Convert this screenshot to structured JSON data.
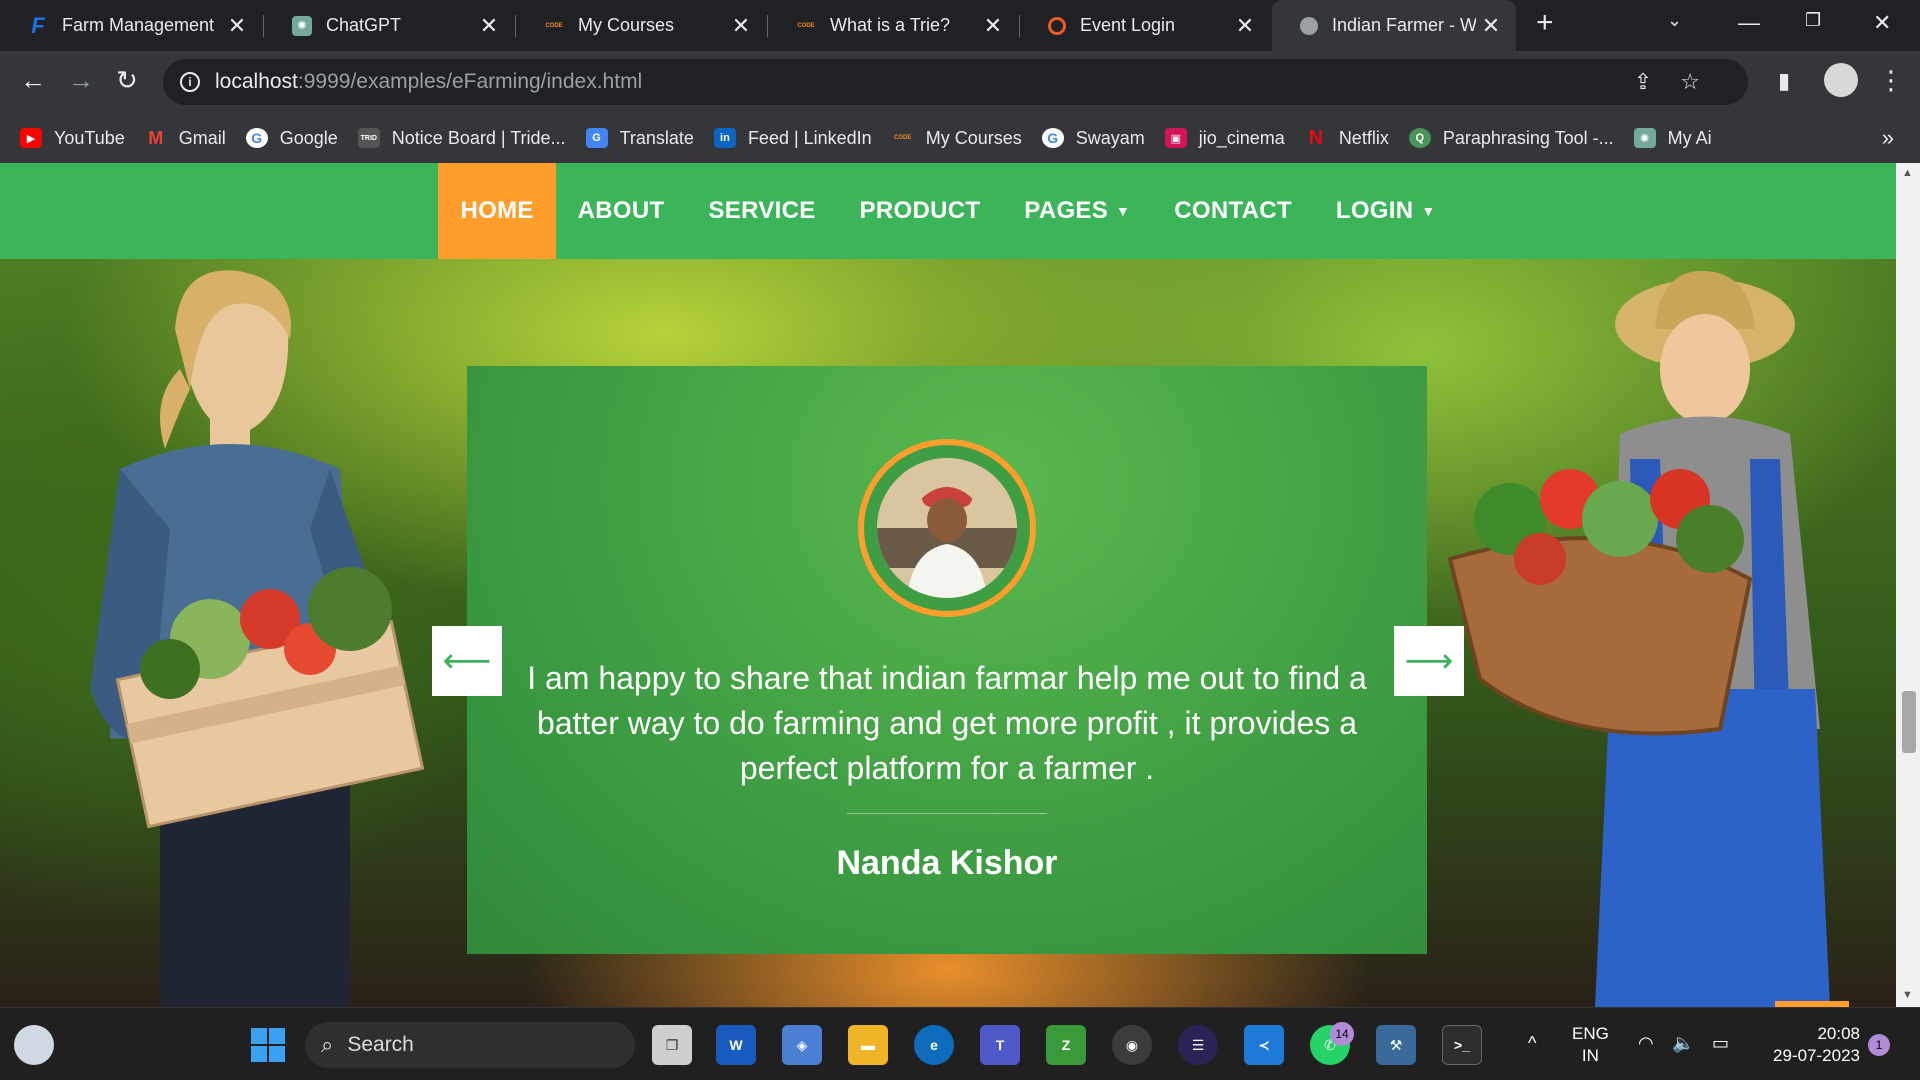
{
  "tabs": [
    {
      "title": "Farm Management",
      "icon": "farm-management-favicon"
    },
    {
      "title": "ChatGPT",
      "icon": "chatgpt-favicon"
    },
    {
      "title": "My Courses",
      "icon": "coding-ninjas-favicon"
    },
    {
      "title": "What is a Trie?",
      "icon": "coding-ninjas-favicon"
    },
    {
      "title": "Event Login",
      "icon": "event-login-favicon"
    },
    {
      "title": "Indian Farmer - We",
      "icon": "globe-favicon"
    }
  ],
  "address_bar": {
    "host": "localhost",
    "path": ":9999/examples/eFarming/index.html"
  },
  "bookmarks": [
    {
      "label": "YouTube",
      "icon": "youtube-icon",
      "color": "#ff0000"
    },
    {
      "label": "Gmail",
      "icon": "gmail-icon",
      "color": "#ea4335"
    },
    {
      "label": "Google",
      "icon": "google-icon",
      "color": "#4285f4"
    },
    {
      "label": "Notice Board | Tride...",
      "icon": "trident-icon",
      "color": "#555555"
    },
    {
      "label": "Translate",
      "icon": "translate-icon",
      "color": "#4285f4"
    },
    {
      "label": "Feed | LinkedIn",
      "icon": "linkedin-icon",
      "color": "#0a66c2"
    },
    {
      "label": "My Courses",
      "icon": "coding-ninjas-icon",
      "color": "#f08a24"
    },
    {
      "label": "Swayam",
      "icon": "google-icon",
      "color": "#4285f4"
    },
    {
      "label": "jio_cinema",
      "icon": "jiocinema-icon",
      "color": "#d4145a"
    },
    {
      "label": "Netflix",
      "icon": "netflix-icon",
      "color": "#e50914"
    },
    {
      "label": "Paraphrasing Tool -...",
      "icon": "quillbot-icon",
      "color": "#499557"
    },
    {
      "label": "My Ai",
      "icon": "chatgpt-icon",
      "color": "#74aa9c"
    }
  ],
  "nav": {
    "home": "HOME",
    "about": "ABOUT",
    "service": "SERVICE",
    "product": "PRODUCT",
    "pages": "PAGES",
    "contact": "CONTACT",
    "login": "LOGIN"
  },
  "testimonial": {
    "quote": "I am happy to share that indian farmar help me out to find a batter way to do farming and get more profit , it provides a perfect platform for a farmer .",
    "author": "Nanda Kishor"
  },
  "colors": {
    "nav_green": "#3cb55a",
    "accent_orange": "#ff9e2c",
    "card_green": "#3f9e43"
  },
  "taskbar": {
    "search_placeholder": "Search",
    "language": "ENG",
    "region": "IN",
    "time": "20:08",
    "date": "29-07-2023",
    "whatsapp_badge": "14",
    "notification_badge": "1"
  }
}
